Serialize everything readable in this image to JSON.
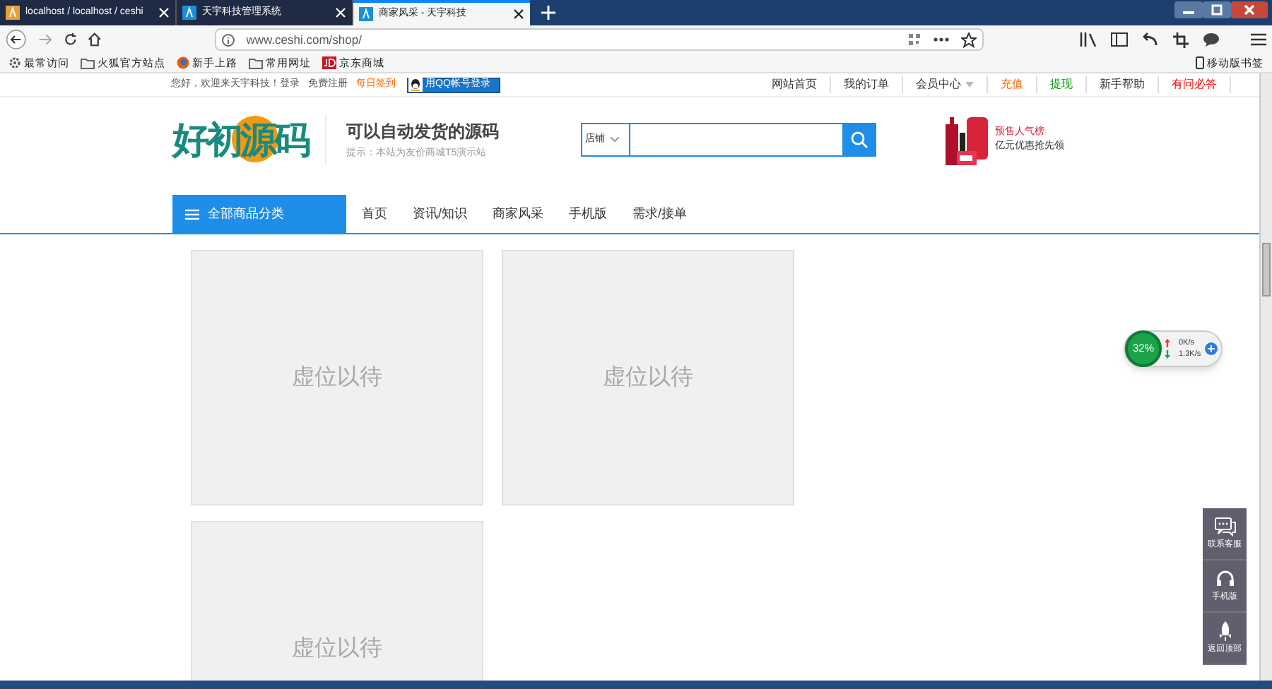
{
  "browser": {
    "tabs": [
      {
        "title": "localhost / localhost / ceshi",
        "selected": false
      },
      {
        "title": "天宇科技管理系统",
        "selected": false
      },
      {
        "title": "商家风采 - 天宇科技",
        "selected": true
      }
    ],
    "url": "www.ceshi.com/shop/",
    "bookmarks": [
      {
        "kind": "gear",
        "label": "最常访问"
      },
      {
        "kind": "folder",
        "label": "火狐官方站点"
      },
      {
        "kind": "fox",
        "label": "新手上路"
      },
      {
        "kind": "folder",
        "label": "常用网址"
      },
      {
        "kind": "jd",
        "label": "京东商城"
      }
    ],
    "mobile_bookmarks": "移动版书签"
  },
  "topbar": {
    "greeting": "您好，欢迎来天宇科技！",
    "login": "登录",
    "register": "免费注册",
    "checkin": "每日签到",
    "qq_login": "用QQ帐号登录",
    "links": [
      {
        "label": "网站首页",
        "color": "#333333",
        "dropdown": false
      },
      {
        "label": "我的订单",
        "color": "#333333",
        "dropdown": false
      },
      {
        "label": "会员中心",
        "color": "#333333",
        "dropdown": true
      },
      {
        "label": "充值",
        "color": "#ff6600",
        "dropdown": false
      },
      {
        "label": "提现",
        "color": "#009900",
        "dropdown": false
      },
      {
        "label": "新手帮助",
        "color": "#333333",
        "dropdown": false
      },
      {
        "label": "有问必答",
        "color": "#ff0000",
        "dropdown": false
      }
    ]
  },
  "header": {
    "logo": "好初源码",
    "slogan": "可以自动发货的源码",
    "tip": "提示：本站为友价商城T5演示站",
    "search": {
      "scope": "店铺"
    },
    "promo": {
      "title": "预售人气榜",
      "subtitle": "亿元优惠抢先领"
    }
  },
  "nav": {
    "category_button": "全部商品分类",
    "items": [
      {
        "label": "首页"
      },
      {
        "label": "资讯/知识"
      },
      {
        "label": "商家风采"
      },
      {
        "label": "手机版"
      },
      {
        "label": "需求/接单"
      }
    ]
  },
  "shops": [
    {
      "placeholder": "虚位以待"
    },
    {
      "placeholder": "虚位以待"
    },
    {
      "placeholder": "虚位以待"
    }
  ],
  "speed_widget": {
    "percent": "32%",
    "upload": "0K/s",
    "download": "1.3K/s"
  },
  "side_tools": [
    {
      "kind": "chat",
      "label": "联系客服"
    },
    {
      "kind": "headset",
      "label": "手机版"
    },
    {
      "kind": "rocket",
      "label": "返回顶部"
    }
  ]
}
